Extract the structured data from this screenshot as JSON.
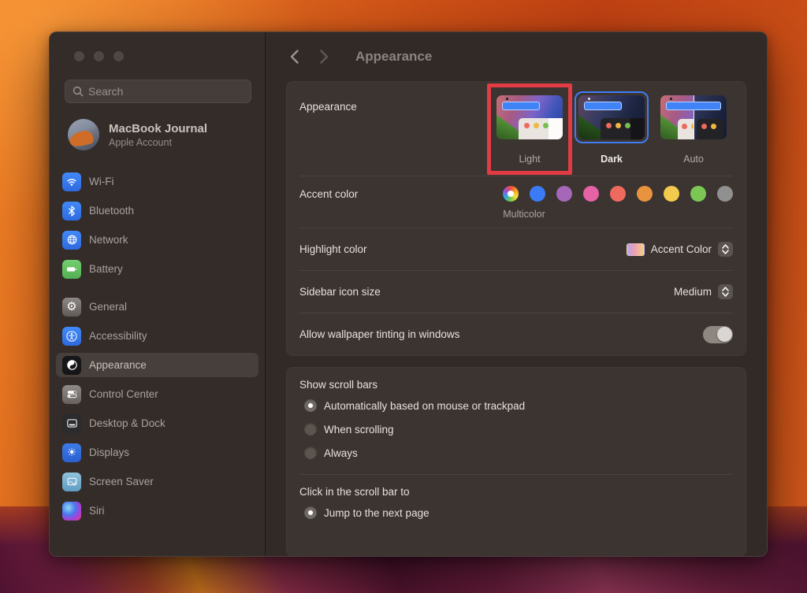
{
  "header": {
    "title": "Appearance"
  },
  "sidebar": {
    "search_placeholder": "Search",
    "account_name": "MacBook Journal",
    "account_subtitle": "Apple Account",
    "items": [
      {
        "label": "Wi-Fi"
      },
      {
        "label": "Bluetooth"
      },
      {
        "label": "Network"
      },
      {
        "label": "Battery"
      },
      {
        "label": "General"
      },
      {
        "label": "Accessibility"
      },
      {
        "label": "Appearance",
        "selected": true
      },
      {
        "label": "Control Center"
      },
      {
        "label": "Desktop & Dock"
      },
      {
        "label": "Displays"
      },
      {
        "label": "Screen Saver"
      },
      {
        "label": "Siri"
      }
    ]
  },
  "appearance_card": {
    "appearance_label": "Appearance",
    "modes": [
      {
        "label": "Light",
        "annotated": true
      },
      {
        "label": "Dark",
        "selected": true
      },
      {
        "label": "Auto"
      }
    ],
    "accent_label": "Accent color",
    "accent_selected_name": "Multicolor",
    "accent_colors": {
      "blue": "#3b7cf6",
      "purple": "#a667b8",
      "pink": "#e562a4",
      "red": "#ee6a5f",
      "orange": "#e9933f",
      "yellow": "#f3c94e",
      "green": "#7bc756",
      "gray": "#909090"
    },
    "highlight_label": "Highlight color",
    "highlight_value": "Accent Color",
    "sidebar_size_label": "Sidebar icon size",
    "sidebar_size_value": "Medium",
    "tinting_label": "Allow wallpaper tinting in windows",
    "tinting_enabled": true
  },
  "scroll_card": {
    "show_label": "Show scroll bars",
    "show_options": [
      {
        "label": "Automatically based on mouse or trackpad",
        "selected": true
      },
      {
        "label": "When scrolling",
        "selected": false
      },
      {
        "label": "Always",
        "selected": false
      }
    ],
    "click_label": "Click in the scroll bar to",
    "click_options": [
      {
        "label": "Jump to the next page",
        "selected": true
      }
    ]
  },
  "annotation": {
    "highlight_box_color": "#e23b43"
  }
}
